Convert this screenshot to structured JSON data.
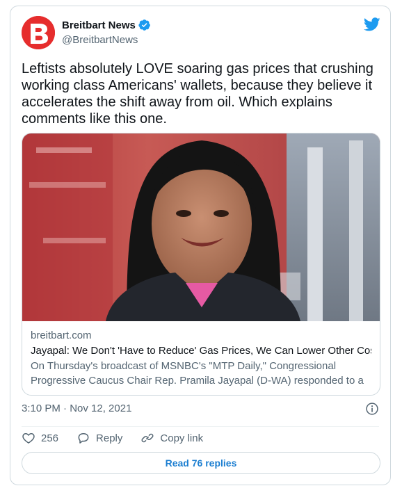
{
  "author": {
    "display_name": "Breitbart News",
    "handle": "@BreitbartNews",
    "avatar_letter": "B",
    "avatar_color": "#e62d2d",
    "verified_icon": "verified-badge-icon"
  },
  "tweet": {
    "text": "Leftists absolutely LOVE soaring gas prices that crushing\nworking class Americans' wallets, because they believe it\naccelerates the shift away from oil. Which explains\ncomments like this one.",
    "timestamp": "3:10 PM · Nov 12, 2021"
  },
  "link_card": {
    "domain": "breitbart.com",
    "title": "Jayapal: We Don't 'Have to Reduce' Gas Prices, We Can Lower Other Cost...",
    "description": "On Thursday's broadcast of MSNBC's \"MTP Daily,\" Congressional Progressive Caucus Chair Rep. Pramila Jayapal (D-WA) responded to a ..."
  },
  "actions": {
    "like_count": "256",
    "reply_label": "Reply",
    "copy_link_label": "Copy link"
  },
  "read_replies_label": "Read 76 replies",
  "colors": {
    "accent": "#1d9bf0",
    "link_button_text": "#1d7fd1",
    "muted_text": "#536471",
    "border": "#cfd9de"
  }
}
